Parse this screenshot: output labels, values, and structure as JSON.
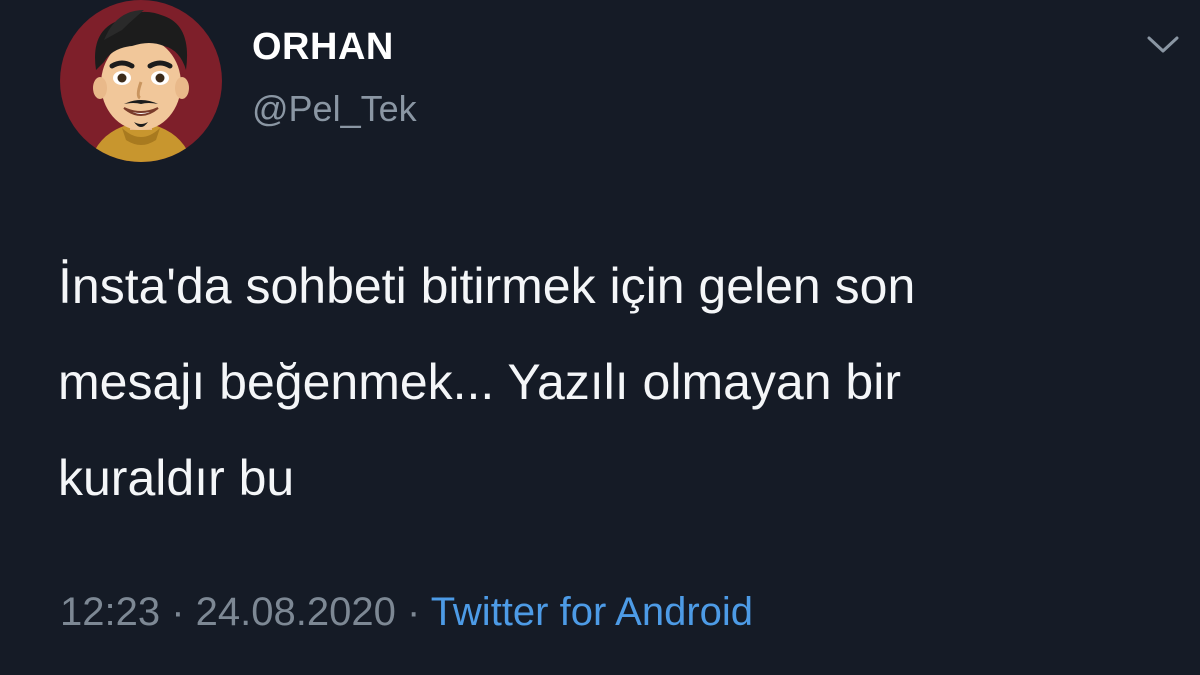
{
  "user": {
    "display_name": "ORHAN",
    "handle": "@Pel_Tek",
    "avatar_icon": "cartoon-avatar-icon"
  },
  "menu": {
    "icon": "chevron-down-icon"
  },
  "tweet": {
    "text": "İnsta'da sohbeti bitirmek için gelen son\nmesajı beğenmek... Yazılı olmayan bir\nkuraldır bu"
  },
  "meta": {
    "time": "12:23",
    "separator1": " · ",
    "date": "24.08.2020",
    "separator2": " · ",
    "source": "Twitter for Android"
  },
  "colors": {
    "background": "#151b26",
    "text": "#f4f6f8",
    "secondary": "#8a96a3",
    "link": "#4d9be6",
    "avatar_bg": "#7e1f2a"
  }
}
